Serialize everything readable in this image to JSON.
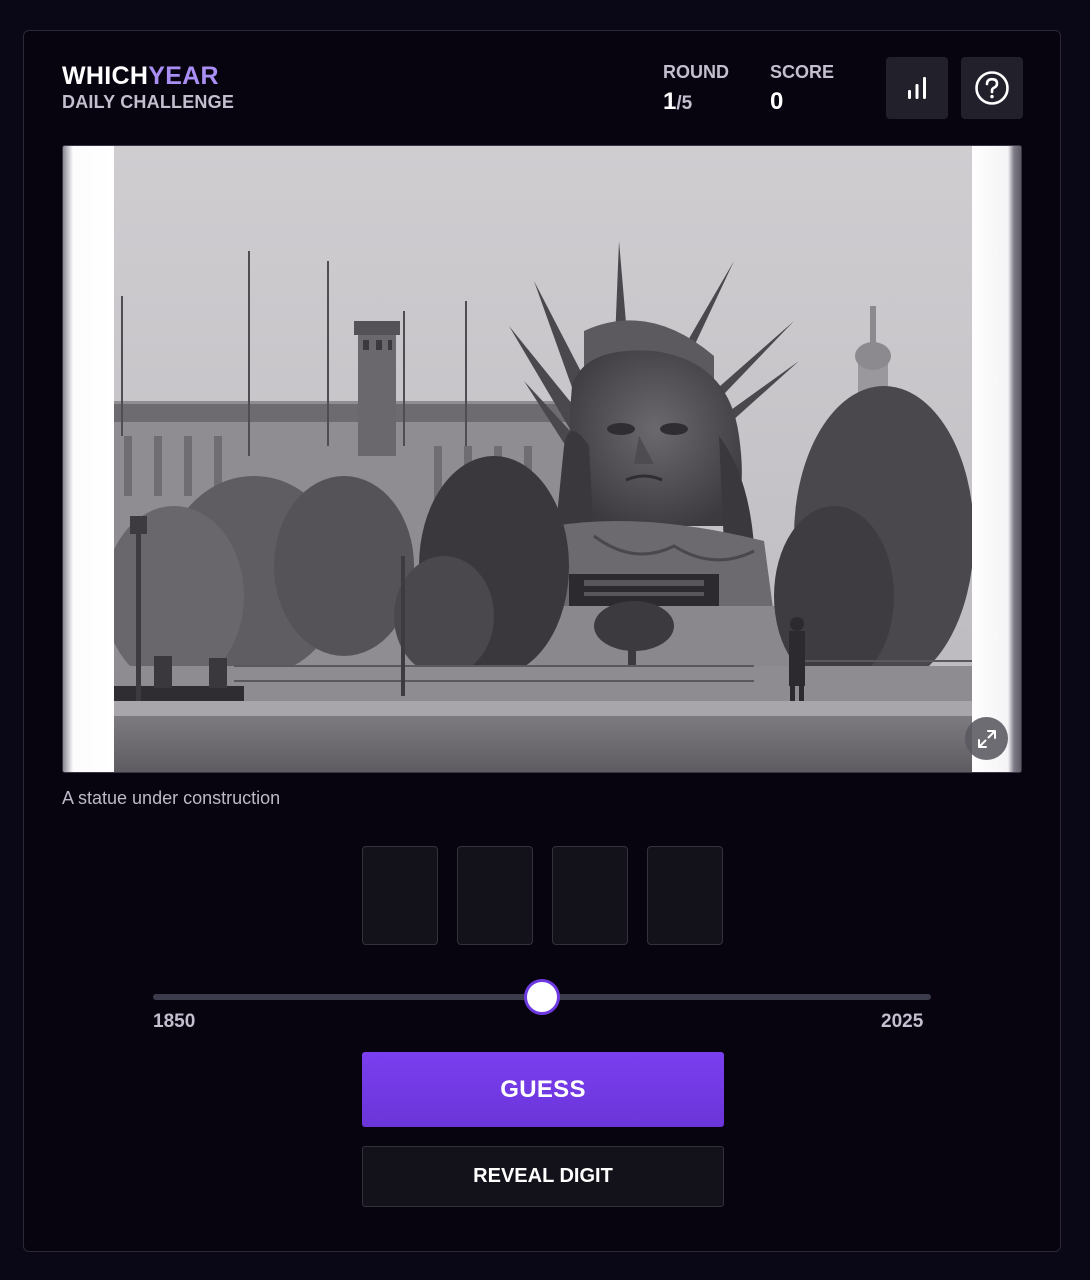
{
  "header": {
    "brand_part1": "WHICH",
    "brand_part2": "YEAR",
    "subtitle": "DAILY CHALLENGE",
    "round_label": "ROUND",
    "round_current": "1",
    "round_total": "/5",
    "score_label": "SCORE",
    "score_value": "0",
    "stats_icon": "bar-chart-icon",
    "help_icon": "question-circle-icon"
  },
  "photo": {
    "description_icon": "historical-photo",
    "expand_icon": "expand-arrows-icon"
  },
  "caption": "A statue under construction",
  "digits": [
    "",
    "",
    "",
    ""
  ],
  "slider": {
    "min_label": "1850",
    "max_label": "2025",
    "value_fraction": 0.5
  },
  "actions": {
    "guess_label": "GUESS",
    "reveal_label": "REVEAL DIGIT"
  },
  "colors": {
    "background": "#0a0717",
    "accent": "#6d3ae0",
    "brand_highlight": "#a98ef3"
  }
}
